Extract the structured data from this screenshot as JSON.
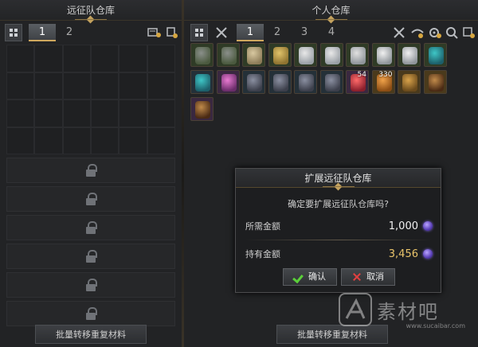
{
  "left": {
    "title": "远征队仓库",
    "tabs": [
      "1",
      "2"
    ],
    "active_tab": 0,
    "locked_rows": 6,
    "bulk_button": "批量转移重复材料"
  },
  "right": {
    "title": "个人仓库",
    "tabs": [
      "1",
      "2",
      "3",
      "4"
    ],
    "active_tab": 0,
    "bulk_button": "批量转移重复材料",
    "items": [
      {
        "icon": "wolf-mount-icon",
        "qty": "",
        "bg": "#2f3b26"
      },
      {
        "icon": "wolf-mount-icon",
        "qty": "",
        "bg": "#2f3b26"
      },
      {
        "icon": "beige-outfit-icon",
        "qty": "",
        "bg": "#2f3b26"
      },
      {
        "icon": "gold-outfit-icon",
        "qty": "",
        "bg": "#2f3b26"
      },
      {
        "icon": "white-scarf-icon",
        "qty": "",
        "bg": "#2f3b26"
      },
      {
        "icon": "white-scarf-icon",
        "qty": "",
        "bg": "#2f3b26"
      },
      {
        "icon": "white-glove-icon",
        "qty": "",
        "bg": "#2f3b26"
      },
      {
        "icon": "white-wings-icon",
        "qty": "",
        "bg": "#2f3b26"
      },
      {
        "icon": "white-wings-icon",
        "qty": "",
        "bg": "#2f3b26"
      },
      {
        "icon": "teal-potion-icon",
        "qty": "",
        "bg": "#2f3b26"
      },
      {
        "icon": "teal-potion-icon",
        "qty": "",
        "bg": "#243038"
      },
      {
        "icon": "pink-sword-icon",
        "qty": "",
        "bg": "#3a2840"
      },
      {
        "icon": "ore-icon",
        "qty": "",
        "bg": "#243038"
      },
      {
        "icon": "ore-icon",
        "qty": "",
        "bg": "#243038"
      },
      {
        "icon": "ore-icon",
        "qty": "",
        "bg": "#243038"
      },
      {
        "icon": "ore-icon",
        "qty": "",
        "bg": "#243038"
      },
      {
        "icon": "red-orb-icon",
        "qty": "54",
        "bg": "#3a2840"
      },
      {
        "icon": "gold-bars-icon",
        "qty": "330",
        "bg": "#4a3a1c"
      },
      {
        "icon": "chest-icon",
        "qty": "",
        "bg": "#4a3a1c"
      },
      {
        "icon": "card-icon",
        "qty": "",
        "bg": "#4a3a1c"
      },
      {
        "icon": "card-icon",
        "qty": "",
        "bg": "#3a2840"
      }
    ]
  },
  "dialog": {
    "title": "扩展远征队仓库",
    "question": "确定要扩展远征队仓库吗?",
    "required_label": "所需金额",
    "required_value": "1,000",
    "owned_label": "持有金额",
    "owned_value": "3,456",
    "confirm_label": "确认",
    "cancel_label": "取消"
  },
  "watermark": {
    "main": "素材吧",
    "sub": "www.sucaibar.com"
  }
}
